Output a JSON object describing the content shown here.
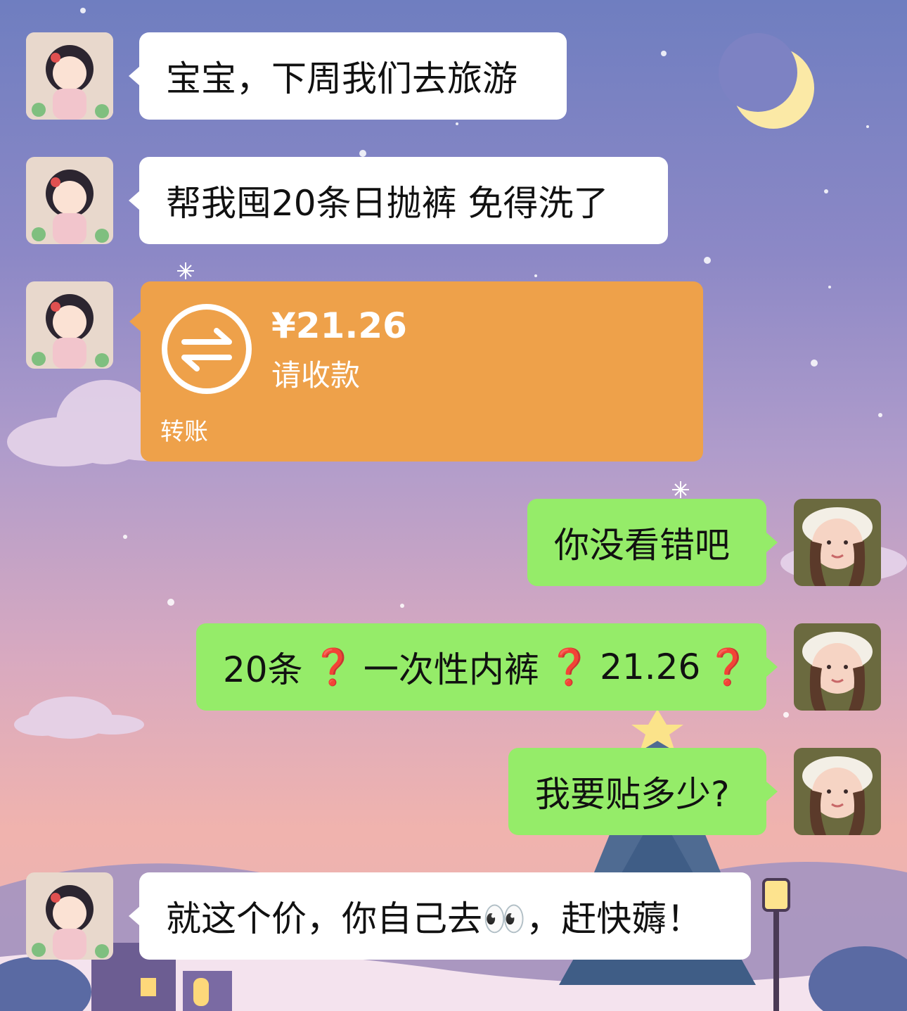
{
  "messages": [
    {
      "side": "left",
      "type": "text",
      "text": "宝宝，下周我们去旅游"
    },
    {
      "side": "left",
      "type": "text",
      "text": "帮我囤20条日抛裤 免得洗了"
    },
    {
      "side": "left",
      "type": "transfer",
      "amount": "¥21.26",
      "status": "请收款",
      "label": "转账",
      "icon": "transfer-arrows-icon"
    },
    {
      "side": "right",
      "type": "text",
      "text": "你没看错吧"
    },
    {
      "side": "right",
      "type": "text",
      "parts": [
        "20条",
        "❓",
        "一次性内裤",
        "❓",
        "21.26",
        "❓"
      ]
    },
    {
      "side": "right",
      "type": "text",
      "text": "我要贴多少?"
    },
    {
      "side": "left",
      "type": "text",
      "text": "就这个价，你自己去👀，赶快薅！"
    }
  ],
  "colors": {
    "bubble_left": "#ffffff",
    "bubble_right": "#95ec69",
    "transfer": "#eea14a",
    "question_mark": "#e0252a"
  },
  "avatars": {
    "left": "cartoon-girl-avatar",
    "right": "photo-girl-avatar"
  }
}
